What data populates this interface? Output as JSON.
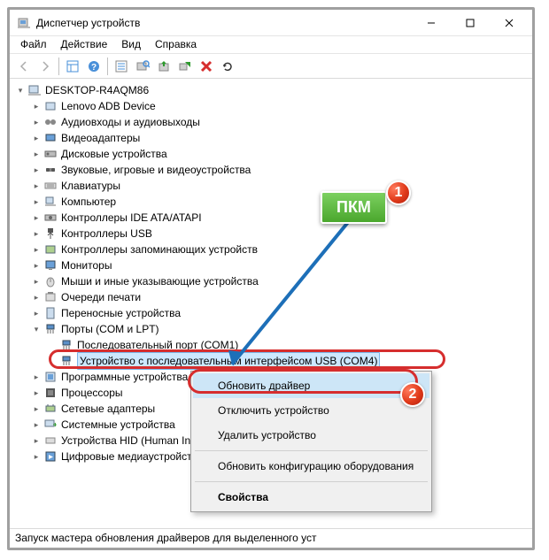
{
  "window": {
    "title": "Диспетчер устройств"
  },
  "menu": {
    "file": "Файл",
    "action": "Действие",
    "view": "Вид",
    "help": "Справка"
  },
  "tree": {
    "root": "DESKTOP-R4AQM86",
    "items": [
      "Lenovo ADB Device",
      "Аудиовходы и аудиовыходы",
      "Видеоадаптеры",
      "Дисковые устройства",
      "Звуковые, игровые и видеоустройства",
      "Клавиатуры",
      "Компьютер",
      "Контроллеры IDE ATA/ATAPI",
      "Контроллеры USB",
      "Контроллеры запоминающих устройств",
      "Мониторы",
      "Мыши и иные указывающие устройства",
      "Очереди печати",
      "Переносные устройства"
    ],
    "ports": {
      "label": "Порты (COM и LPT)",
      "children": [
        "Последовательный порт (COM1)",
        "Устройство с последовательным интерфейсом USB (COM4)"
      ]
    },
    "after": [
      "Программные устройства",
      "Процессоры",
      "Сетевые адаптеры",
      "Системные устройства",
      "Устройства HID (Human Inte",
      "Цифровые медиаустройства"
    ]
  },
  "context": {
    "update": "Обновить драйвер",
    "disable": "Отключить устройство",
    "uninstall": "Удалить устройство",
    "scan": "Обновить конфигурацию оборудования",
    "props": "Свойства"
  },
  "callouts": {
    "tooltip": "ПКМ",
    "badge1": "1",
    "badge2": "2"
  },
  "status": "Запуск мастера обновления драйверов для выделенного уст"
}
